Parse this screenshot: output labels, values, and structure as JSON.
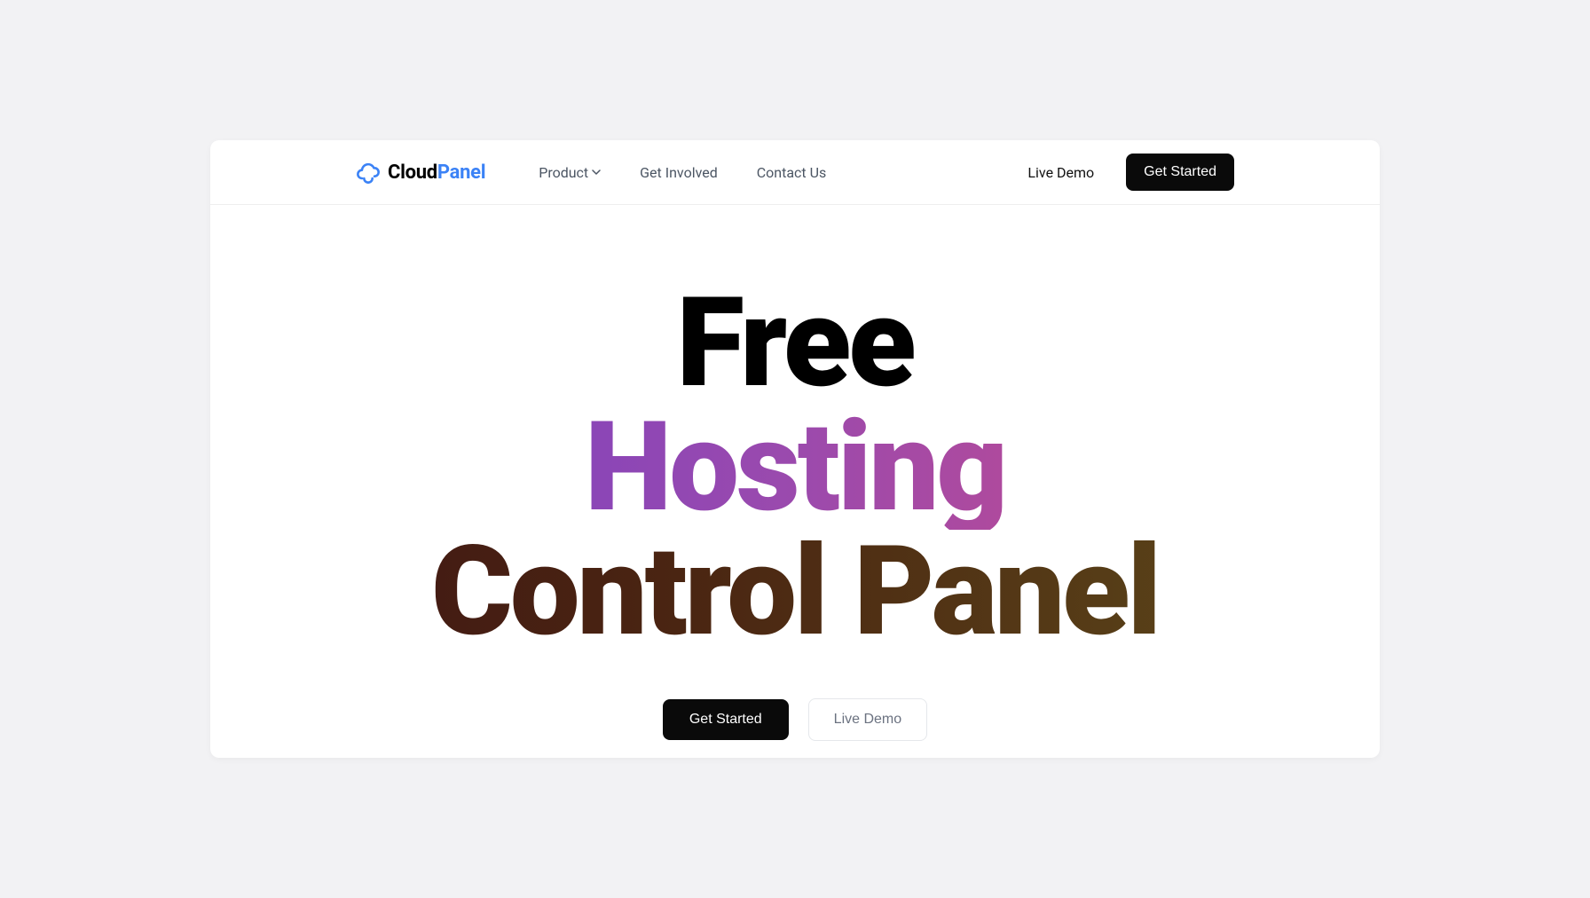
{
  "logo": {
    "text_part1": "Cloud",
    "text_part2": "Panel",
    "icon_color": "#3b82f6"
  },
  "nav": {
    "product": "Product",
    "get_involved": "Get Involved",
    "contact_us": "Contact Us"
  },
  "topbar_right": {
    "live_demo": "Live Demo",
    "get_started": "Get Started"
  },
  "hero": {
    "line1": "Free",
    "line2": "Hosting",
    "line3": "Control Panel"
  },
  "hero_actions": {
    "get_started": "Get Started",
    "live_demo": "Live Demo"
  }
}
